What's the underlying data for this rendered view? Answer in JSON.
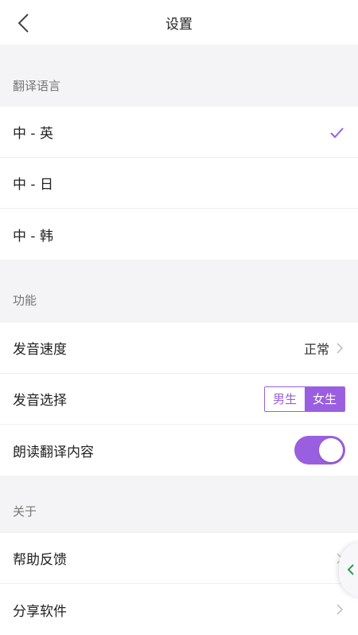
{
  "nav": {
    "title": "设置"
  },
  "sections": {
    "translate": {
      "title": "翻译语言"
    },
    "features": {
      "title": "功能"
    },
    "about": {
      "title": "关于"
    }
  },
  "languages": [
    {
      "label": "中 - 英",
      "selected": true
    },
    {
      "label": "中 - 日",
      "selected": false
    },
    {
      "label": "中 - 韩",
      "selected": false
    }
  ],
  "features": {
    "speed": {
      "label": "发音速度",
      "value": "正常"
    },
    "voice": {
      "label": "发音选择",
      "options": [
        "男生",
        "女生"
      ],
      "selected": "女生"
    },
    "read_aloud": {
      "label": "朗读翻译内容",
      "enabled": true
    }
  },
  "about": [
    {
      "label": "帮助反馈"
    },
    {
      "label": "分享软件"
    }
  ],
  "colors": {
    "accent": "#9a5fe0",
    "background": "#f4f4f6"
  }
}
